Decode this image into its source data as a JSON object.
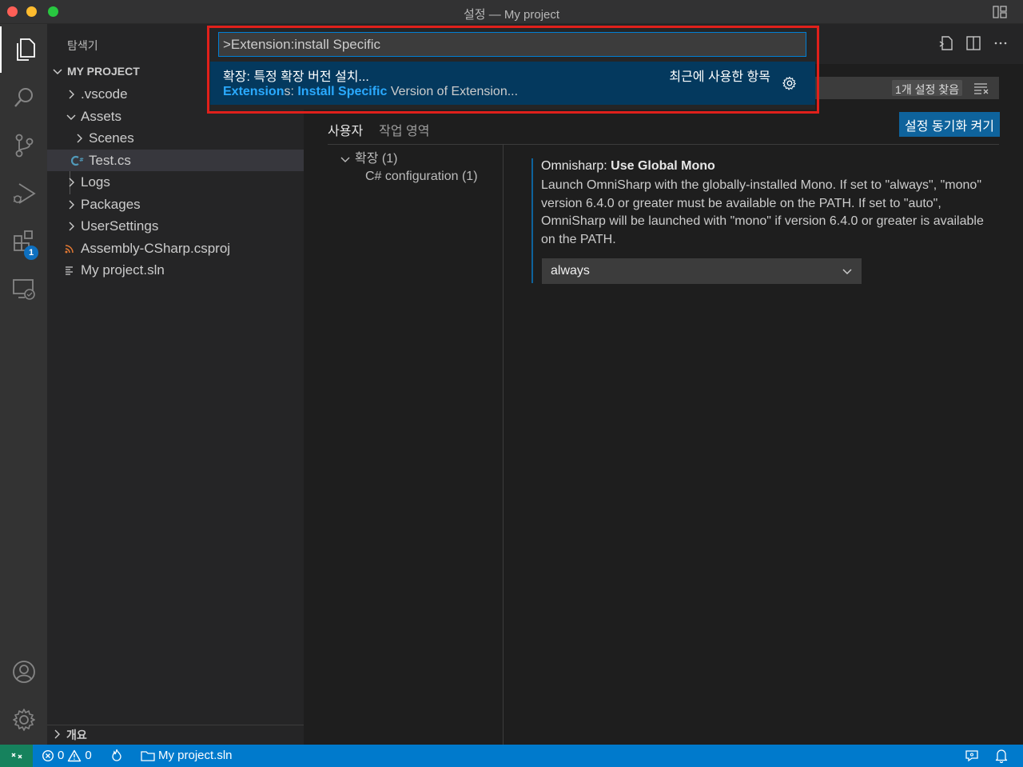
{
  "window": {
    "title": "설정 — My project"
  },
  "explorer": {
    "title": "탐색기",
    "project": "MY PROJECT",
    "items": [
      {
        "label": ".vscode",
        "kind": "folder",
        "expanded": false
      },
      {
        "label": "Assets",
        "kind": "folder",
        "expanded": true
      },
      {
        "label": "Scenes",
        "kind": "folder",
        "expanded": false
      },
      {
        "label": "Test.cs",
        "kind": "csharp-file",
        "selected": true
      },
      {
        "label": "Logs",
        "kind": "folder",
        "expanded": false
      },
      {
        "label": "Packages",
        "kind": "folder",
        "expanded": false
      },
      {
        "label": "UserSettings",
        "kind": "folder",
        "expanded": false
      },
      {
        "label": "Assembly-CSharp.csproj",
        "kind": "rss-file"
      },
      {
        "label": "My project.sln",
        "kind": "lines-file"
      }
    ],
    "outline": "개요"
  },
  "activity": {
    "extensions_badge": "1"
  },
  "settings": {
    "found_count": "1개 설정 찾음",
    "sync_button": "설정 동기화 켜기",
    "tabs": [
      "사용자",
      "작업 영역"
    ],
    "toc": {
      "group": "확장 (1)",
      "child": "C# configuration (1)"
    },
    "setting": {
      "category": "Omnisharp: ",
      "name": "Use Global Mono",
      "description": "Launch OmniSharp with the globally-installed Mono. If set to \"always\", \"mono\" version 6.4.0 or greater must be available on the PATH. If set to \"auto\", OmniSharp will be launched with \"mono\" if version 6.4.0 or greater is available on the PATH.",
      "value": "always"
    }
  },
  "palette": {
    "input": ">Extension:install Specific",
    "item_label": "확장: 특정 확장 버전 설치...",
    "recent": "최근에 사용한 항목",
    "detail": {
      "hl1": "Extension",
      "plain1": "s: ",
      "hl2": "Install Specific",
      "plain2": " Version of Extension..."
    }
  },
  "status": {
    "errors": "0",
    "warnings": "0",
    "solution": "My project.sln"
  },
  "colors": {
    "accent": "#007acc",
    "remote": "#16825d",
    "highlight_frame": "#e0201b",
    "selection": "#04395e"
  }
}
